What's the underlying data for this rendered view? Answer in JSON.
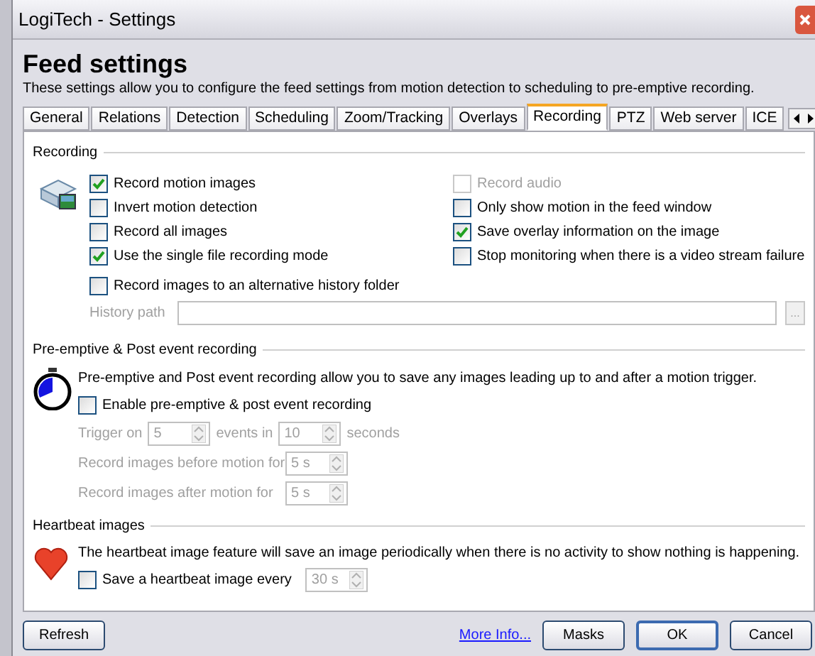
{
  "window": {
    "title": "LogiTech - Settings"
  },
  "header": {
    "title": "Feed settings",
    "description": "These settings allow you to configure the feed settings from motion detection to scheduling to pre-emptive recording."
  },
  "tabs": [
    {
      "label": "General",
      "selected": false
    },
    {
      "label": "Relations",
      "selected": false
    },
    {
      "label": "Detection",
      "selected": false
    },
    {
      "label": "Scheduling",
      "selected": false
    },
    {
      "label": "Zoom/Tracking",
      "selected": false
    },
    {
      "label": "Overlays",
      "selected": false
    },
    {
      "label": "Recording",
      "selected": true
    },
    {
      "label": "PTZ",
      "selected": false
    },
    {
      "label": "Web server",
      "selected": false
    },
    {
      "label": "ICE",
      "selected": false
    }
  ],
  "recording": {
    "title": "Recording",
    "options_left": [
      {
        "label": "Record motion images",
        "checked": true,
        "disabled": false
      },
      {
        "label": "Invert motion detection",
        "checked": false,
        "disabled": false
      },
      {
        "label": "Record all images",
        "checked": false,
        "disabled": false
      },
      {
        "label": "Use the single file recording mode",
        "checked": true,
        "disabled": false
      }
    ],
    "options_right": [
      {
        "label": "Record audio",
        "checked": false,
        "disabled": true
      },
      {
        "label": "Only show motion in the feed window",
        "checked": false,
        "disabled": false
      },
      {
        "label": "Save overlay information on the image",
        "checked": true,
        "disabled": false
      },
      {
        "label": "Stop monitoring when there is a video stream failure",
        "checked": false,
        "disabled": false
      }
    ],
    "alt_folder": {
      "label": "Record images to an alternative history folder",
      "checked": false,
      "disabled": false
    },
    "history_path": {
      "label": "History path",
      "disabled": true
    },
    "browse_button": "..."
  },
  "preemptive": {
    "title": "Pre-emptive & Post event recording",
    "description": "Pre-emptive and Post event recording allow you to save any images leading up to and after a motion trigger.",
    "enable": {
      "label": "Enable pre-emptive & post event recording",
      "checked": false,
      "disabled": false
    },
    "trigger_on": {
      "label": "Trigger on",
      "value": "5",
      "disabled": true
    },
    "events_in": {
      "label": "events in",
      "value": "10",
      "disabled": true
    },
    "seconds_label": "seconds",
    "before": {
      "label": "Record images before motion for",
      "value": "5 s",
      "disabled": true
    },
    "after": {
      "label": "Record images after motion for",
      "value": "5 s",
      "disabled": true
    }
  },
  "heartbeat": {
    "title": "Heartbeat images",
    "description": "The heartbeat image feature will save an image periodically when there is no activity to show nothing is happening.",
    "enable": {
      "label": "Save a heartbeat image every",
      "checked": false,
      "disabled": false
    },
    "interval": {
      "value": "30 s",
      "disabled": true
    }
  },
  "footer": {
    "refresh": "Refresh",
    "more_info": "More Info...",
    "masks": "Masks",
    "ok": "OK",
    "cancel": "Cancel"
  }
}
